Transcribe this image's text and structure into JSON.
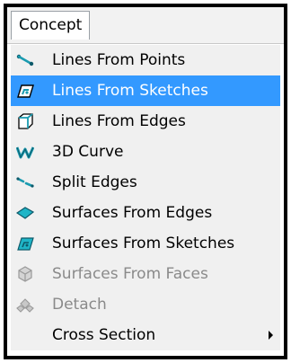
{
  "menubar": {
    "title": "Concept"
  },
  "menu": {
    "items": [
      {
        "label": "Lines From Points",
        "icon": "line-from-points-icon",
        "state": "normal"
      },
      {
        "label": "Lines From Sketches",
        "icon": "line-from-sketch-icon",
        "state": "highlighted"
      },
      {
        "label": "Lines From Edges",
        "icon": "line-from-edges-icon",
        "state": "normal"
      },
      {
        "label": "3D Curve",
        "icon": "3d-curve-icon",
        "state": "normal"
      },
      {
        "label": "Split Edges",
        "icon": "split-edges-icon",
        "state": "normal"
      },
      {
        "label": "Surfaces From Edges",
        "icon": "surface-from-edges-icon",
        "state": "normal"
      },
      {
        "label": "Surfaces From Sketches",
        "icon": "surface-from-sketch-icon",
        "state": "normal"
      },
      {
        "label": "Surfaces From Faces",
        "icon": "surface-from-faces-icon",
        "state": "disabled"
      },
      {
        "label": "Detach",
        "icon": "detach-icon",
        "state": "disabled"
      },
      {
        "label": "Cross Section",
        "icon": "",
        "state": "normal",
        "submenu": true
      }
    ]
  },
  "colors": {
    "highlight": "#3399ff",
    "icon_teal": "#1a9bb0",
    "disabled": "#8a8a8a"
  }
}
